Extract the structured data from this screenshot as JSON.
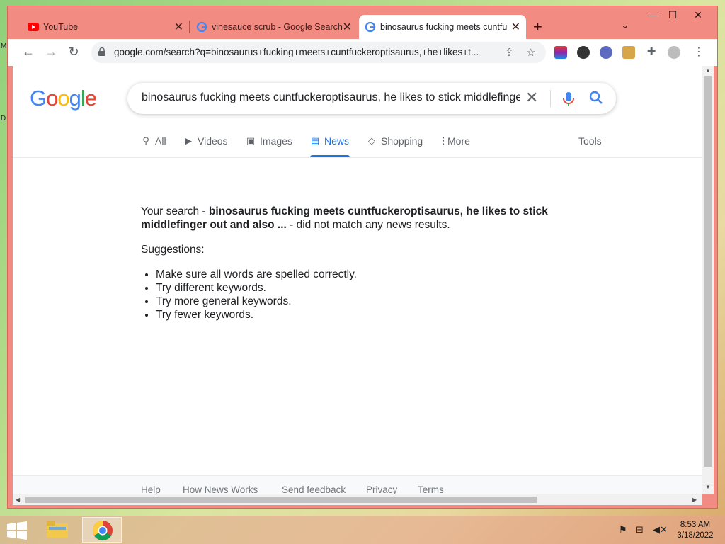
{
  "desktop": {
    "edge_letters": [
      "M",
      "D"
    ]
  },
  "browser": {
    "tabs": [
      {
        "title": "YouTube",
        "icon": "youtube-icon",
        "active": false
      },
      {
        "title": "vinesauce scrub - Google Search",
        "icon": "google-g-icon",
        "active": false
      },
      {
        "title": "binosaurus fucking meets cuntfu",
        "icon": "google-g-icon",
        "active": true
      }
    ],
    "new_tab_symbol": "+",
    "url": "google.com/search?q=binosaurus+fucking+meets+cuntfuckeroptisaurus,+he+likes+t...",
    "theme_color": "#f28b82"
  },
  "google": {
    "logo_text": "Google",
    "query": "binosaurus fucking meets cuntfuckeroptisaurus, he likes to stick middlefinger",
    "nav_tabs": [
      {
        "label": "All",
        "icon": "search-icon",
        "active": false
      },
      {
        "label": "Videos",
        "icon": "video-icon",
        "active": false
      },
      {
        "label": "Images",
        "icon": "image-icon",
        "active": false
      },
      {
        "label": "News",
        "icon": "news-icon",
        "active": true
      },
      {
        "label": "Shopping",
        "icon": "tag-icon",
        "active": false
      },
      {
        "label": "More",
        "icon": "more-vert-icon",
        "active": false
      }
    ],
    "tools_label": "Tools",
    "accent_color": "#1a73e8"
  },
  "results": {
    "prefix": "Your search - ",
    "query_bold": "binosaurus fucking meets cuntfuckeroptisaurus, he likes to stick middlefinger out and also ...",
    "suffix": " - did not match any news results.",
    "suggestions_heading": "Suggestions:",
    "suggestions": [
      "Make sure all words are spelled correctly.",
      "Try different keywords.",
      "Try more general keywords.",
      "Try fewer keywords."
    ]
  },
  "footer": {
    "links": [
      "Help",
      "How News Works",
      "Send feedback",
      "Privacy",
      "Terms"
    ]
  },
  "taskbar": {
    "time": "8:53 AM",
    "date": "3/18/2022"
  }
}
